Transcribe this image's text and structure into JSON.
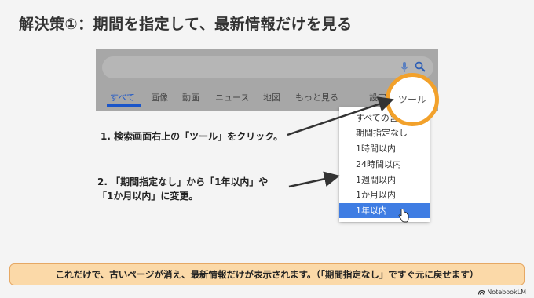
{
  "title": "解決策①：期間を指定して、最新情報だけを見る",
  "search": {
    "icons": [
      "mic-icon",
      "search-icon"
    ],
    "tabs": [
      "すべて",
      "画像",
      "動画",
      "ニュース",
      "地図",
      "もっと見る"
    ],
    "active_tab": "すべて",
    "settings_label": "設定",
    "tools_label": "ツール"
  },
  "dropdown": {
    "items": [
      "すべての言語",
      "期間指定なし",
      "1時間以内",
      "24時間以内",
      "1週間以内",
      "1か月以内",
      "1年以内"
    ],
    "selected": "1年以内"
  },
  "steps": {
    "step1": "1. 検索画面右上の「ツール」をクリック。",
    "step2_line1": "2. 「期間指定なし」から「1年以内」や",
    "step2_line2": "「1か月以内」に変更。"
  },
  "banner": "これだけで、古いページが消え、最新情報だけが表示されます。（「期間指定なし」ですぐ元に戻せます）",
  "brand": "NotebookLM",
  "colors": {
    "highlight_ring": "#f2a12b",
    "selected_item": "#3f7de3",
    "banner_bg": "#fbd9a8"
  }
}
